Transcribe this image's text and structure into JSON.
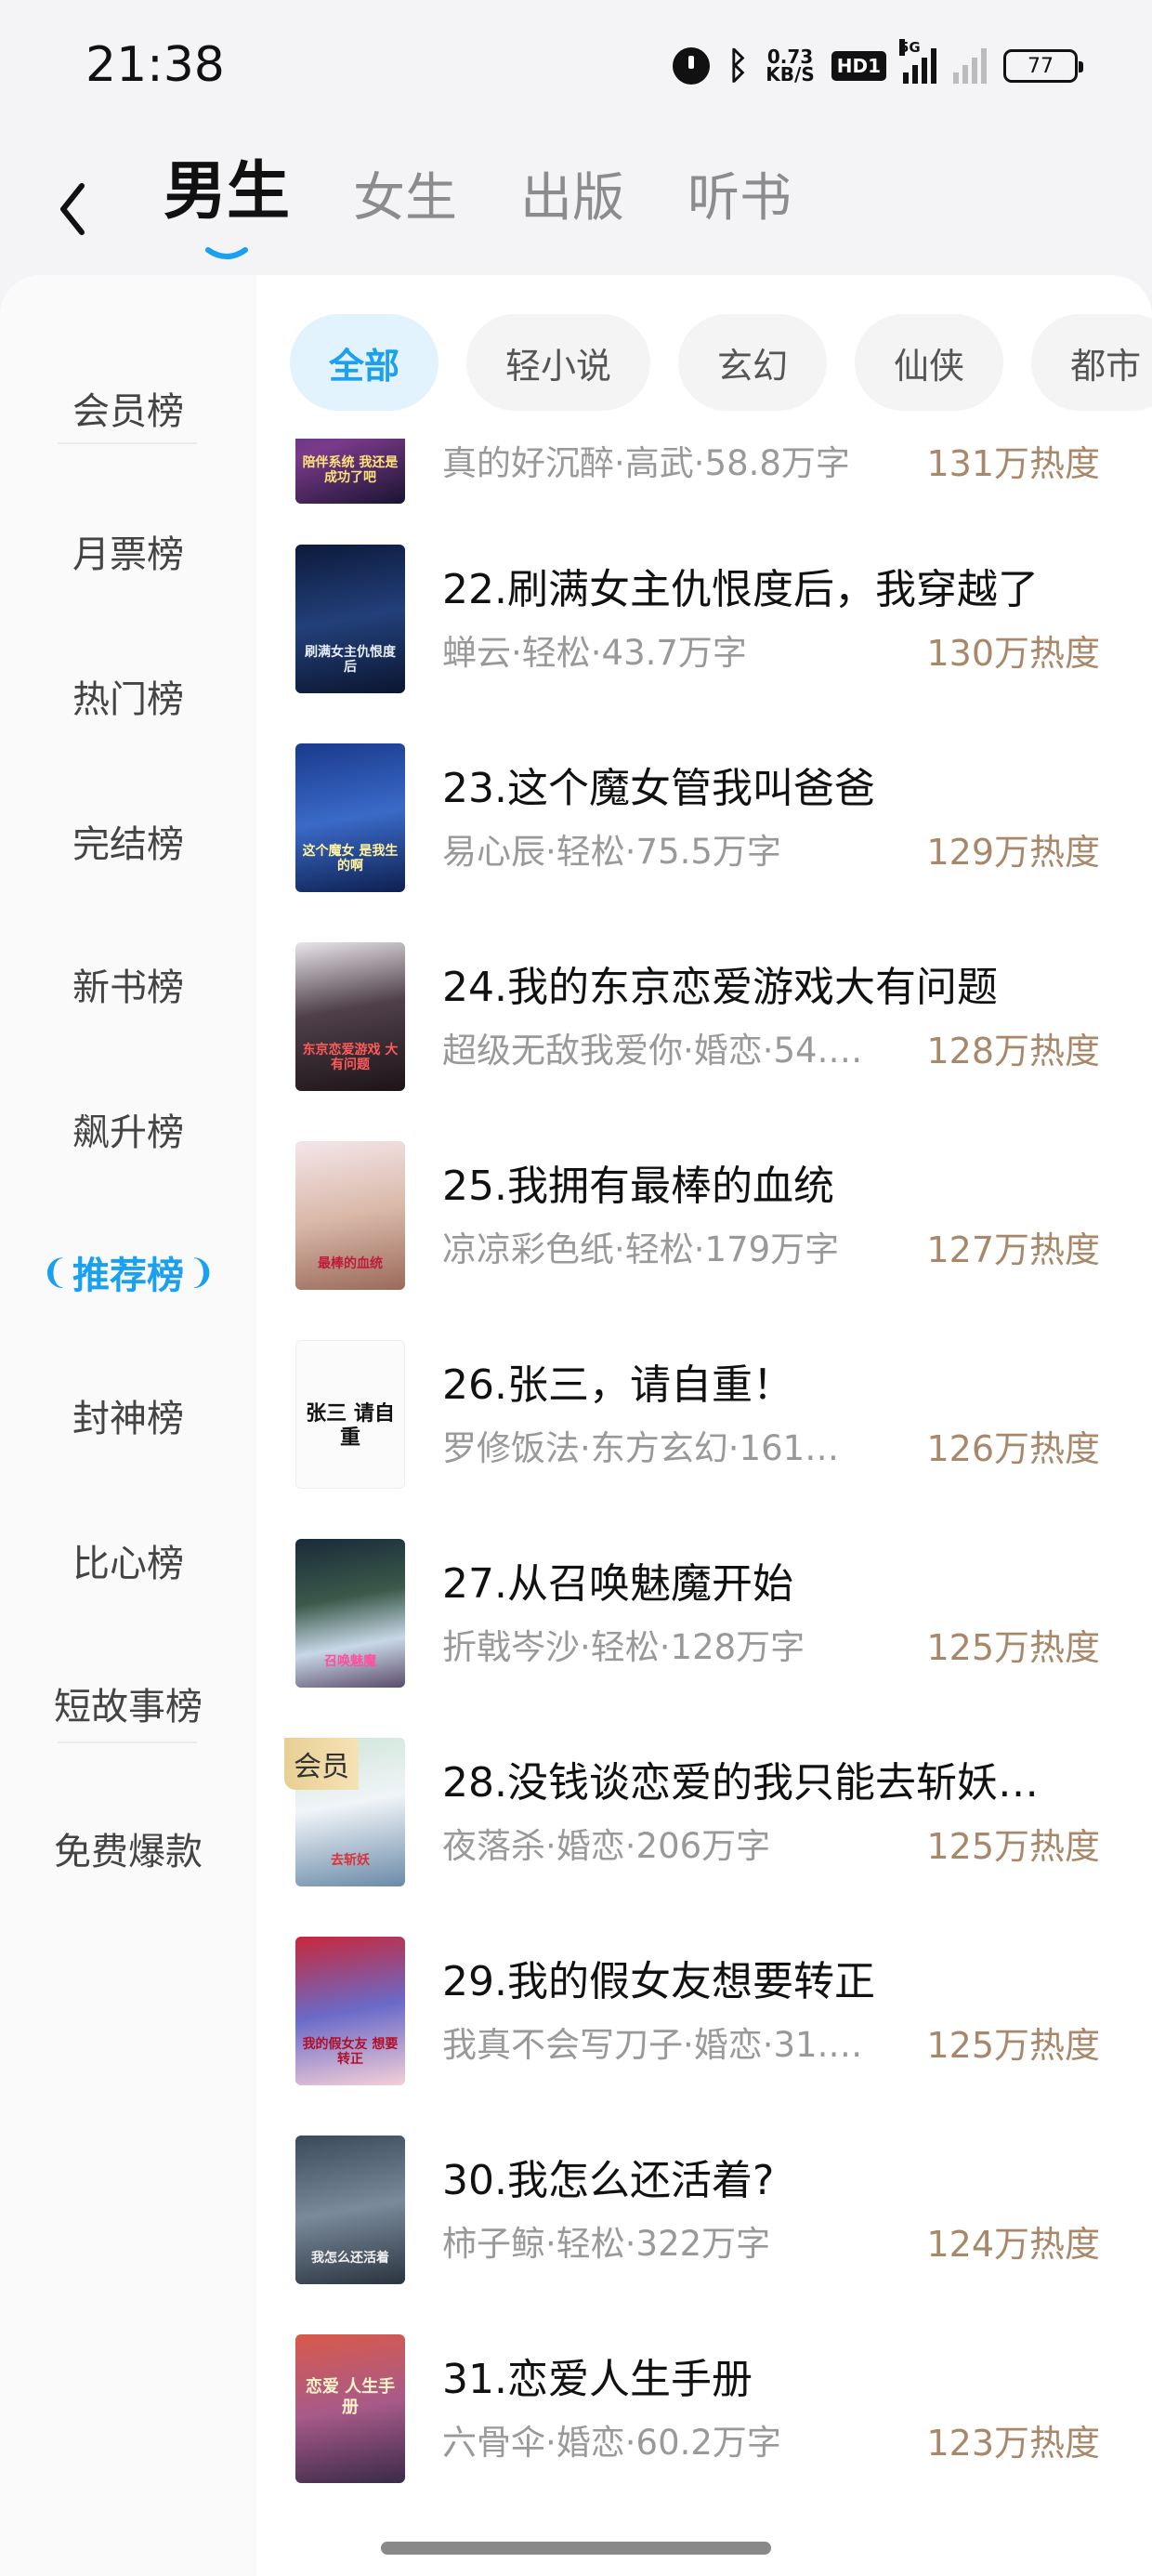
{
  "status": {
    "time": "21:38",
    "net_speed_value": "0.73",
    "net_speed_unit": "KB/S",
    "hd_label": "HD1",
    "signal_label": "5G",
    "battery": "77",
    "icons": [
      "alarm-icon",
      "bluetooth-icon",
      "hd-icon",
      "signal-icon",
      "battery-icon"
    ]
  },
  "nav": {
    "tabs": [
      "男生",
      "女生",
      "出版",
      "听书"
    ],
    "active_tab": "男生",
    "accent_color": "#1aa0f0"
  },
  "sidebar": {
    "items": [
      "会员榜",
      "月票榜",
      "热门榜",
      "完结榜",
      "新书榜",
      "飙升榜",
      "推荐榜",
      "封神榜",
      "比心榜",
      "短故事榜",
      "免费爆款"
    ],
    "active_item": "推荐榜"
  },
  "categories": {
    "chips": [
      "全部",
      "轻小说",
      "玄幻",
      "仙侠",
      "都市"
    ],
    "active_chip": "全部"
  },
  "books": [
    {
      "title": "",
      "meta": "真的好沉醉·高武·58.8万字",
      "heat": "131万热度",
      "cover_text": "陪伴系统 我还是成功了吧",
      "badge": ""
    },
    {
      "title": "22.刷满女主仇恨度后，我穿越了",
      "meta": "蝉云·轻松·43.7万字",
      "heat": "130万热度",
      "cover_text": "刷满女主仇恨度后",
      "badge": ""
    },
    {
      "title": "23.这个魔女管我叫爸爸",
      "meta": "易心辰·轻松·75.5万字",
      "heat": "129万热度",
      "cover_text": "这个魔女 是我生的啊",
      "badge": ""
    },
    {
      "title": "24.我的东京恋爱游戏大有问题",
      "meta": "超级无敌我爱你·婚恋·54.…",
      "heat": "128万热度",
      "cover_text": "东京恋爱游戏 大有问题",
      "badge": ""
    },
    {
      "title": "25.我拥有最棒的血统",
      "meta": "凉凉彩色纸·轻松·179万字",
      "heat": "127万热度",
      "cover_text": "最棒的血统",
      "badge": ""
    },
    {
      "title": "26.张三，请自重！",
      "meta": "罗修饭法·东方玄幻·161…",
      "heat": "126万热度",
      "cover_text": "张三 请自重",
      "badge": ""
    },
    {
      "title": "27.从召唤魅魔开始",
      "meta": "折戟岑沙·轻松·128万字",
      "heat": "125万热度",
      "cover_text": "召唤魅魔",
      "badge": ""
    },
    {
      "title": "28.没钱谈恋爱的我只能去斩妖…",
      "meta": "夜落杀·婚恋·206万字",
      "heat": "125万热度",
      "cover_text": "去斩妖",
      "badge": "会员"
    },
    {
      "title": "29.我的假女友想要转正",
      "meta": "我真不会写刀子·婚恋·31.…",
      "heat": "125万热度",
      "cover_text": "我的假女友 想要转正",
      "badge": ""
    },
    {
      "title": "30.我怎么还活着?",
      "meta": "柿子鲸·轻松·322万字",
      "heat": "124万热度",
      "cover_text": "我怎么还活着",
      "badge": ""
    },
    {
      "title": "31.恋爱人生手册",
      "meta": "六骨伞·婚恋·60.2万字",
      "heat": "123万热度",
      "cover_text": "恋爱 人生手册",
      "badge": ""
    }
  ]
}
